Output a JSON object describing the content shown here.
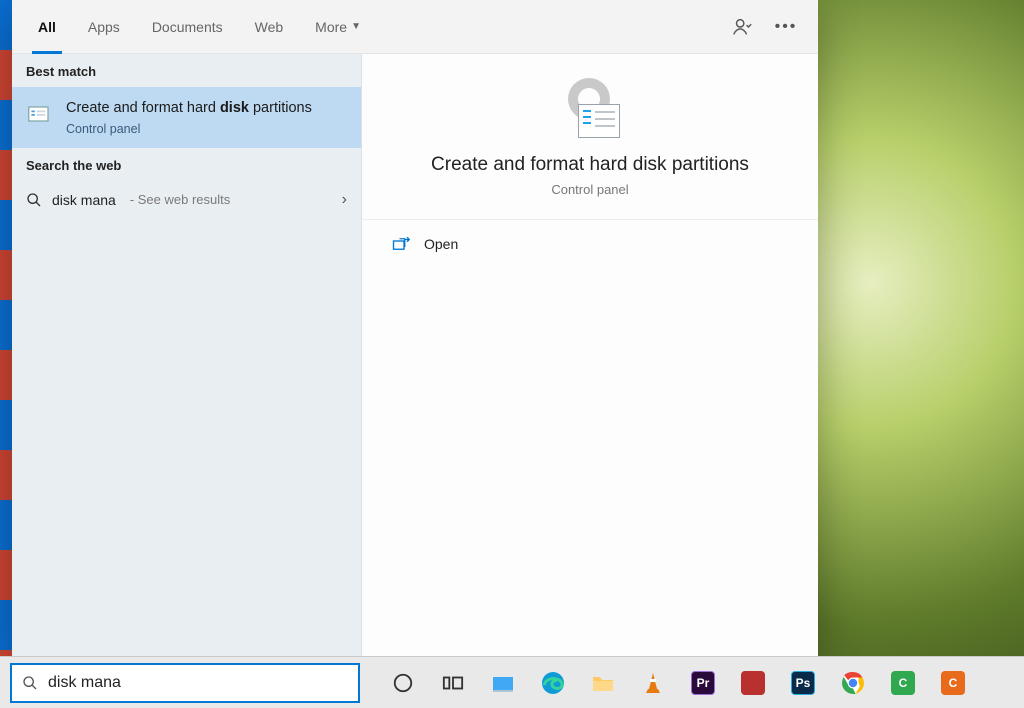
{
  "tabs": {
    "all": "All",
    "apps": "Apps",
    "documents": "Documents",
    "web": "Web",
    "more": "More"
  },
  "sections": {
    "best_match": "Best match",
    "search_web": "Search the web"
  },
  "best_match": {
    "title_pre": "Create and format hard ",
    "title_bold": "disk",
    "title_post": " partitions",
    "subtitle": "Control panel"
  },
  "web_result": {
    "query": "disk mana",
    "hint": "- See web results"
  },
  "preview": {
    "title": "Create and format hard disk partitions",
    "subtitle": "Control panel"
  },
  "actions": {
    "open": "Open"
  },
  "search": {
    "value": "disk mana"
  },
  "taskbar": {
    "pr": "Pr",
    "ps": "Ps",
    "c1": "C",
    "c2": "C"
  }
}
